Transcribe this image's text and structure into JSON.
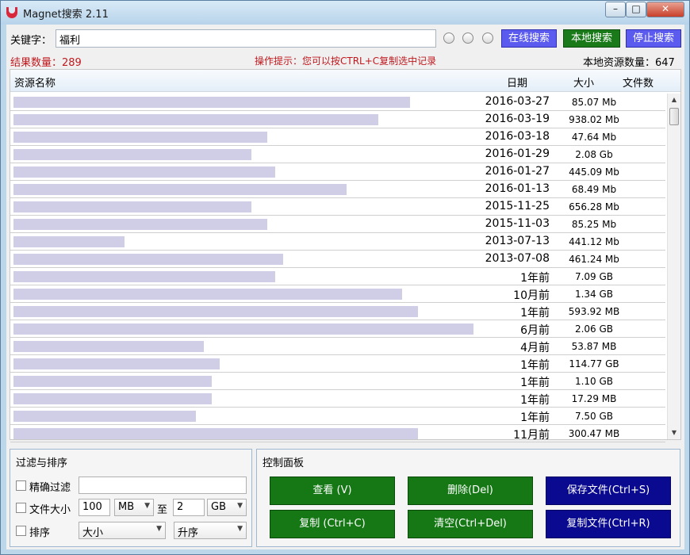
{
  "window": {
    "title": "Magnet搜索 2.11"
  },
  "search": {
    "keyword_label": "关键字：",
    "keyword_value": "福利",
    "online_search": "在线搜索",
    "local_search": "本地搜索",
    "stop_search": "停止搜索"
  },
  "status": {
    "result_count": "结果数量：289",
    "hint": "操作提示：您可以按CTRL+C复制选中记录",
    "local_count": "本地资源数量：647"
  },
  "table": {
    "headers": {
      "name": "资源名称",
      "date": "日期",
      "size": "大小",
      "files": "文件数"
    },
    "rows": [
      {
        "date": "2016-03-27",
        "size": "85.07 Mb"
      },
      {
        "date": "2016-03-19",
        "size": "938.02 Mb"
      },
      {
        "date": "2016-03-18",
        "size": "47.64 Mb"
      },
      {
        "date": "2016-01-29",
        "size": "2.08 Gb"
      },
      {
        "date": "2016-01-27",
        "size": "445.09 Mb"
      },
      {
        "date": "2016-01-13",
        "size": "68.49 Mb"
      },
      {
        "date": "2015-11-25",
        "size": "656.28 Mb"
      },
      {
        "date": "2015-11-03",
        "size": "85.25 Mb"
      },
      {
        "date": "2013-07-13",
        "size": "441.12 Mb"
      },
      {
        "date": "2013-07-08",
        "size": "461.24 Mb"
      },
      {
        "date": "1年前",
        "size": "7.09 GB"
      },
      {
        "date": "10月前",
        "size": "1.34 GB"
      },
      {
        "date": "1年前",
        "size": "593.92 MB"
      },
      {
        "date": "6月前",
        "size": "2.06 GB"
      },
      {
        "date": "4月前",
        "size": "53.87 MB"
      },
      {
        "date": "1年前",
        "size": "114.77 GB"
      },
      {
        "date": "1年前",
        "size": "1.10 GB"
      },
      {
        "date": "1年前",
        "size": "17.29 MB"
      },
      {
        "date": "1年前",
        "size": "7.50 GB"
      },
      {
        "date": "11月前",
        "size": "300.47 MB"
      }
    ]
  },
  "filter": {
    "title": "过滤与排序",
    "exact_label": "精确过滤",
    "exact_value": "",
    "size_label": "文件大小",
    "size_min": "100",
    "size_min_unit": "MB",
    "to_label": "至",
    "size_max": "2",
    "size_max_unit": "GB",
    "sort_label": "排序",
    "sort_by": "大小",
    "sort_order": "升序"
  },
  "control": {
    "title": "控制面板",
    "view": "查看 (V)",
    "delete": "删除(Del)",
    "save": "保存文件(Ctrl+S)",
    "copy": "复制 (Ctrl+C)",
    "clear": "清空(Ctrl+Del)",
    "export": "复制文件(Ctrl+R)"
  },
  "colors": {
    "accent_blue": "#5b5bf0",
    "button_green": "#157815",
    "hint_red": "#c0191e"
  }
}
